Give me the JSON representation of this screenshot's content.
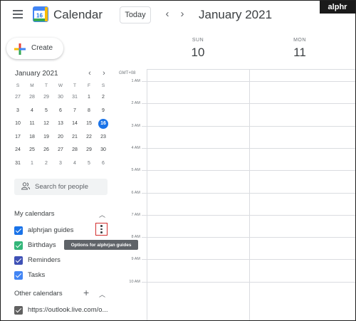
{
  "header": {
    "app_title": "Calendar",
    "logo_day": "16",
    "today_label": "Today",
    "prev_icon": "‹",
    "next_icon": "›",
    "date_title": "January 2021",
    "brand": "alphr"
  },
  "create": {
    "label": "Create"
  },
  "mini_calendar": {
    "month_label": "January 2021",
    "prev_icon": "‹",
    "next_icon": "›",
    "weekdays": [
      "S",
      "M",
      "T",
      "W",
      "T",
      "F",
      "S"
    ],
    "weeks": [
      [
        "27",
        "28",
        "29",
        "30",
        "31",
        "1",
        "2"
      ],
      [
        "3",
        "4",
        "5",
        "6",
        "7",
        "8",
        "9"
      ],
      [
        "10",
        "11",
        "12",
        "13",
        "14",
        "15",
        "16"
      ],
      [
        "17",
        "18",
        "19",
        "20",
        "21",
        "22",
        "23"
      ],
      [
        "24",
        "25",
        "26",
        "27",
        "28",
        "29",
        "30"
      ],
      [
        "31",
        "1",
        "2",
        "3",
        "4",
        "5",
        "6"
      ]
    ],
    "today": "16"
  },
  "search_people": {
    "placeholder": "Search for people"
  },
  "my_calendars": {
    "title": "My calendars",
    "items": [
      {
        "label": "alphrjan guides",
        "color": "#1a73e8"
      },
      {
        "label": "Birthdays",
        "color": "#33b679"
      },
      {
        "label": "Reminders",
        "color": "#3f51b5"
      },
      {
        "label": "Tasks",
        "color": "#4285f4"
      }
    ],
    "options_tooltip": "Options for alphrjan guides"
  },
  "other_calendars": {
    "title": "Other calendars",
    "items": [
      {
        "label": "https://outlook.live.com/o...",
        "color": "#616161"
      }
    ]
  },
  "week_view": {
    "timezone": "GMT+08",
    "days": [
      {
        "dow": "SUN",
        "num": "10"
      },
      {
        "dow": "MON",
        "num": "11"
      }
    ],
    "hours": [
      "1 AM",
      "2 AM",
      "3 AM",
      "4 AM",
      "5 AM",
      "6 AM",
      "7 AM",
      "8 AM",
      "9 AM",
      "10 AM"
    ]
  },
  "colors": {
    "accent": "#1a73e8",
    "options_highlight": "#d32f2f"
  }
}
